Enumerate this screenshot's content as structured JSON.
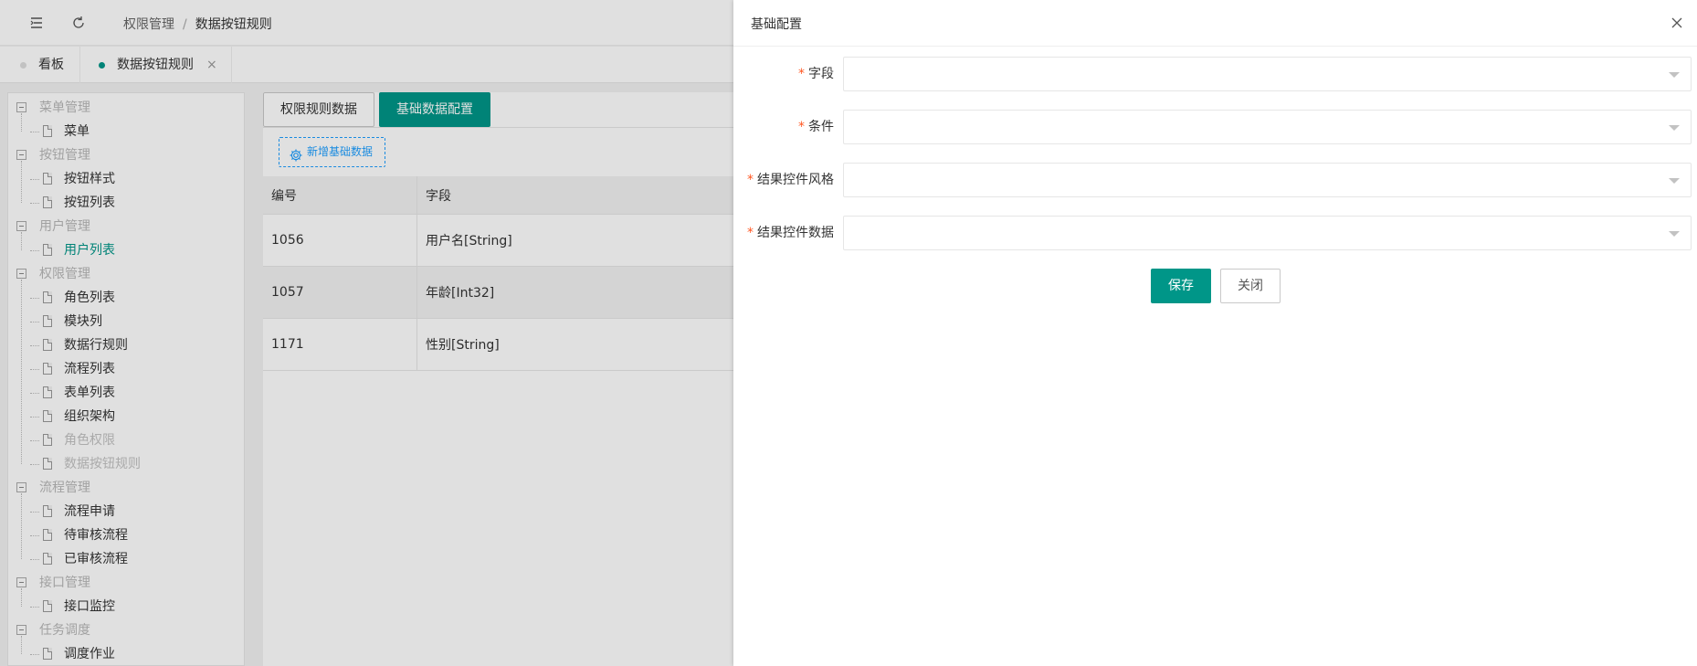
{
  "header": {
    "menu_icon": "menu-fold-icon",
    "refresh_icon": "refresh-icon",
    "breadcrumb": [
      "权限管理",
      "数据按钮规则"
    ],
    "separator": "/"
  },
  "tabs": [
    {
      "label": "看板",
      "active": false
    },
    {
      "label": "数据按钮规则",
      "active": true,
      "close": "×"
    }
  ],
  "colors": {
    "accent": "#009688",
    "link": "#1e9fff",
    "required": "#ff5722"
  },
  "sidebar": {
    "groups": [
      {
        "label": "菜单管理",
        "items": [
          {
            "label": "菜单",
            "state": "normal"
          }
        ]
      },
      {
        "label": "按钮管理",
        "items": [
          {
            "label": "按钮样式",
            "state": "normal"
          },
          {
            "label": "按钮列表",
            "state": "normal"
          }
        ]
      },
      {
        "label": "用户管理",
        "items": [
          {
            "label": "用户列表",
            "state": "active"
          }
        ]
      },
      {
        "label": "权限管理",
        "items": [
          {
            "label": "角色列表",
            "state": "normal"
          },
          {
            "label": "模块列",
            "state": "normal"
          },
          {
            "label": "数据行规则",
            "state": "normal"
          },
          {
            "label": "流程列表",
            "state": "normal"
          },
          {
            "label": "表单列表",
            "state": "normal"
          },
          {
            "label": "组织架构",
            "state": "normal"
          },
          {
            "label": "角色权限",
            "state": "disabled"
          },
          {
            "label": "数据按钮规则",
            "state": "disabled"
          }
        ]
      },
      {
        "label": "流程管理",
        "items": [
          {
            "label": "流程申请",
            "state": "normal"
          },
          {
            "label": "待审核流程",
            "state": "normal"
          },
          {
            "label": "已审核流程",
            "state": "normal"
          }
        ]
      },
      {
        "label": "接口管理",
        "items": [
          {
            "label": "接口监控",
            "state": "normal"
          }
        ]
      },
      {
        "label": "任务调度",
        "items": [
          {
            "label": "调度作业",
            "state": "normal"
          }
        ]
      }
    ]
  },
  "content": {
    "tabs": [
      "权限规则数据",
      "基础数据配置"
    ],
    "active_tab": 1,
    "add_button": "新增基础数据",
    "table": {
      "columns": [
        "编号",
        "字段"
      ],
      "rows": [
        [
          "1056",
          "用户名[String]"
        ],
        [
          "1057",
          "年龄[Int32]"
        ],
        [
          "1171",
          "性别[String]"
        ]
      ]
    }
  },
  "drawer": {
    "title": "基础配置",
    "fields": [
      {
        "label": "字段",
        "required": "*",
        "value": ""
      },
      {
        "label": "条件",
        "required": "*",
        "value": ""
      },
      {
        "label": "结果控件风格",
        "required": "*",
        "value": ""
      },
      {
        "label": "结果控件数据",
        "required": "*",
        "value": ""
      }
    ],
    "save_label": "保存",
    "close_label": "关闭"
  }
}
